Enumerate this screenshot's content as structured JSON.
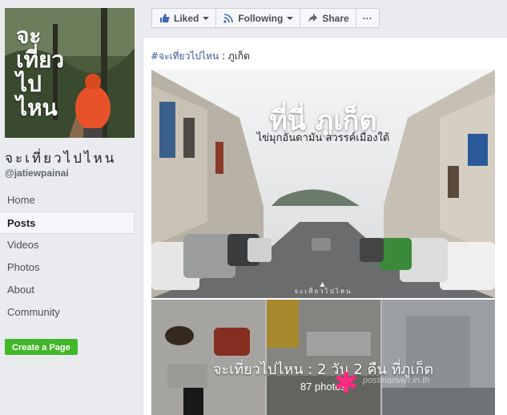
{
  "page": {
    "name": "จะเที่ยวไปไหน",
    "handle": "@jatiewpainai",
    "cover_text": [
      "จะ",
      "เที่ยว",
      "ไป",
      "ไหน"
    ]
  },
  "nav": {
    "items": [
      {
        "label": "Home",
        "active": false
      },
      {
        "label": "Posts",
        "active": true
      },
      {
        "label": "Videos",
        "active": false
      },
      {
        "label": "Photos",
        "active": false
      },
      {
        "label": "About",
        "active": false
      },
      {
        "label": "Community",
        "active": false
      }
    ]
  },
  "create_page_label": "Create a Page",
  "actions": {
    "liked": "Liked",
    "following": "Following",
    "share": "Share",
    "more": "···"
  },
  "post": {
    "hashtag": "#จะเที่ยวไปไหน",
    "location": " : ภูเก็ต",
    "photo_title": "ที่นี่ ภูเก็ต",
    "photo_subtitle": "ไข่มุกอันดามัน     สวรรค์เมืองใต้",
    "photo_watermark": "▲\nจะเที่ยวไปไหน",
    "album_title": "จะเที่ยวไปไหน : 2 วัน 2 คืน ที่ภูเก็ต",
    "album_count": "87 photos",
    "album_watermark": "postmanvier.in.th"
  },
  "colors": {
    "link": "#365899",
    "green": "#42b72a",
    "accent_star": "#ff2a7f"
  }
}
